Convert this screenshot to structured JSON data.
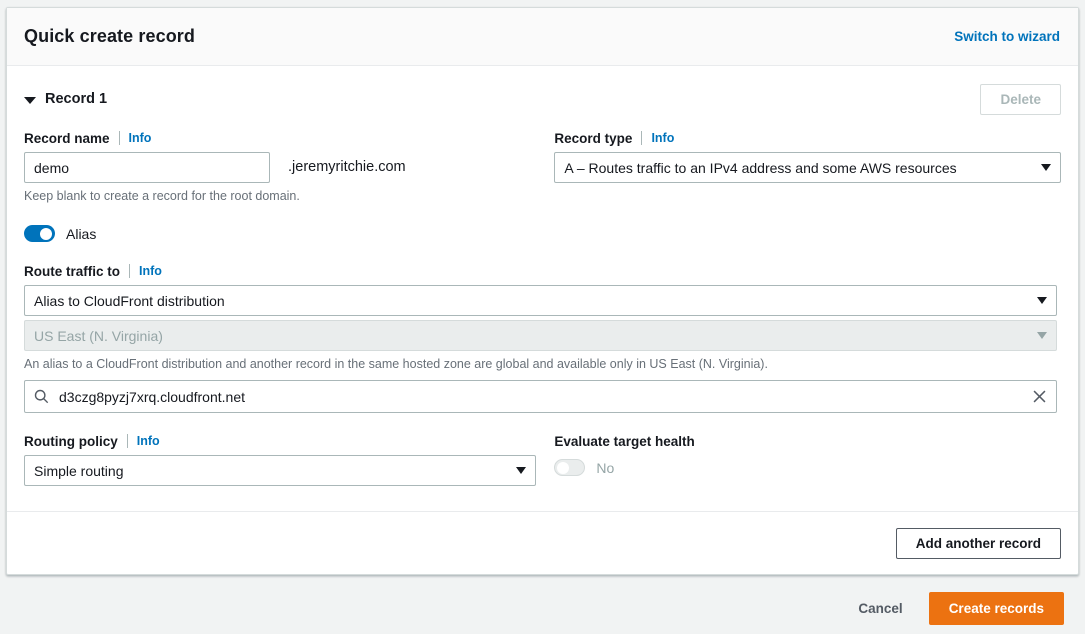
{
  "header": {
    "title": "Quick create record",
    "switch_link": "Switch to wizard"
  },
  "record": {
    "title": "Record 1",
    "delete_label": "Delete",
    "name_label": "Record name",
    "info_label": "Info",
    "name_value": "demo",
    "domain_suffix": ".jeremyritchie.com",
    "name_hint": "Keep blank to create a record for the root domain.",
    "type_label": "Record type",
    "type_value": "A – Routes traffic to an IPv4 address and some AWS resources",
    "alias_label": "Alias",
    "alias_on": true,
    "route_label": "Route traffic to",
    "route_value": "Alias to CloudFront distribution",
    "region_value": "US East (N. Virginia)",
    "region_disabled": true,
    "alias_hint": "An alias to a CloudFront distribution and another record in the same hosted zone are global and available only in US East (N. Virginia).",
    "endpoint_value": "d3czg8pyzj7xrq.cloudfront.net",
    "routing_policy_label": "Routing policy",
    "routing_policy_value": "Simple routing",
    "health_label": "Evaluate target health",
    "health_value": "No",
    "health_on": false
  },
  "actions": {
    "add_another": "Add another record",
    "cancel": "Cancel",
    "create": "Create records"
  },
  "colors": {
    "accent_orange": "#ec7211",
    "link_blue": "#0073bb",
    "toggle_on": "#0073bb",
    "page_bg": "#f1f3f3"
  }
}
